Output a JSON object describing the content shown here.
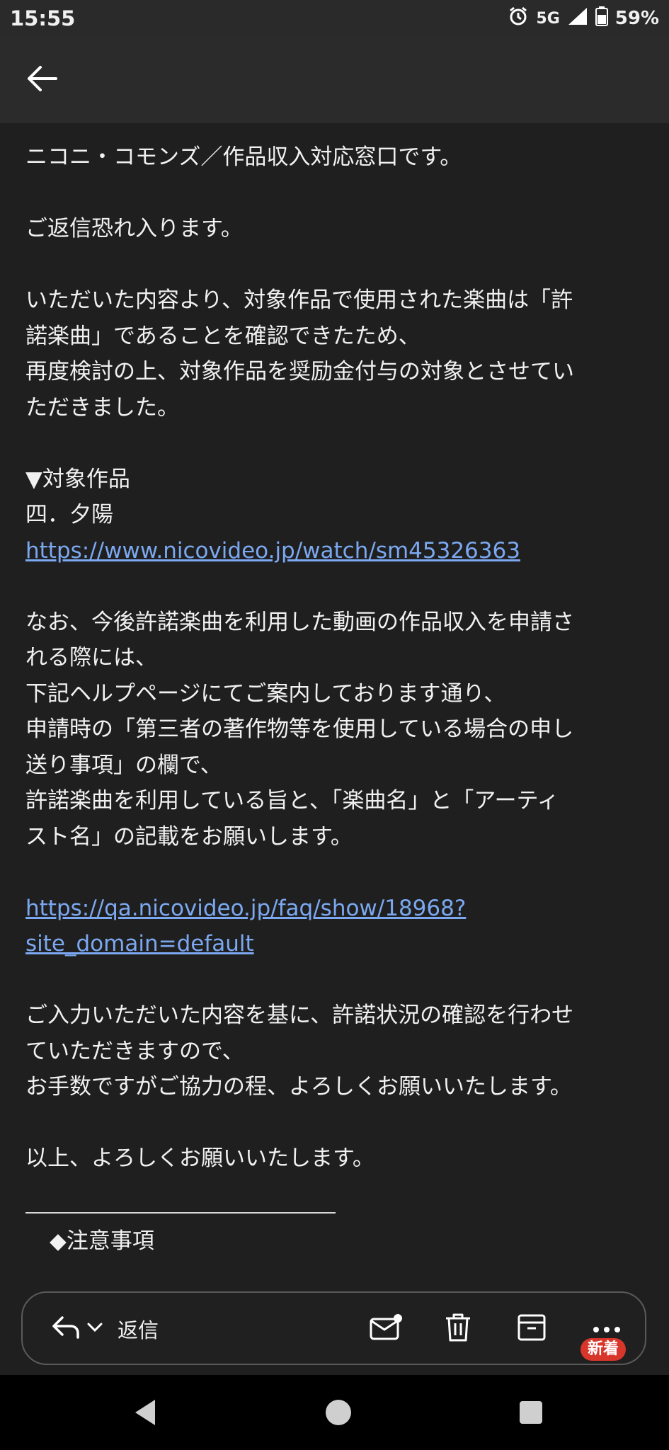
{
  "status_bar": {
    "time": "15:55",
    "network": "5G",
    "battery": "59%",
    "icons": [
      "alarm-icon",
      "signal-icon",
      "battery-icon"
    ]
  },
  "header": {
    "back_icon": "arrow-left-icon"
  },
  "body": {
    "p1": "ニコニ・コモンズ／作品収入対応窓口です。",
    "p2": "ご返信恐れ入ります。",
    "p3_l1": "いただいた内容より、対象作品で使用された楽曲は「許",
    "p3_l2": "諾楽曲」であることを確認できたため、",
    "p3_l3": "再度検討の上、対象作品を奨励金付与の対象とさせてい",
    "p3_l4": "ただきました。",
    "target_heading": "▼対象作品",
    "target_title": "四．夕陽",
    "target_link": "https://www.nicovideo.jp/watch/sm45326363",
    "p4_l1": "なお、今後許諾楽曲を利用した動画の作品収入を申請さ",
    "p4_l2": "れる際には、",
    "p4_l3": "下記ヘルプページにてご案内しております通り、",
    "p4_l4": "申請時の「第三者の著作物等を使用している場合の申し",
    "p4_l5": "送り事項」の欄で、",
    "p4_l6": "許諾楽曲を利用している旨と、「楽曲名」と「アーティ",
    "p4_l7": "スト名」の記載をお願いします。",
    "help_link_l1": "https://qa.nicovideo.jp/faq/show/18968?",
    "help_link_l2": "site_domain=default",
    "p5_l1": "ご入力いただいた内容を基に、許諾状況の確認を行わせ",
    "p5_l2": "ていただきますので、",
    "p5_l3": "お手数ですがご協力の程、よろしくお願いいたします。",
    "p6": "以上、よろしくお願いいたします。",
    "notice_heading": "◆注意事項"
  },
  "action_bar": {
    "reply_label": "返信",
    "badge": "新着",
    "icons": [
      "reply-icon",
      "chevron-down-icon",
      "mark-unread-icon",
      "delete-icon",
      "archive-icon",
      "more-icon"
    ]
  },
  "colors": {
    "background": "#1f1f1f",
    "link": "#7ba8f0",
    "badge": "#d9362b"
  }
}
